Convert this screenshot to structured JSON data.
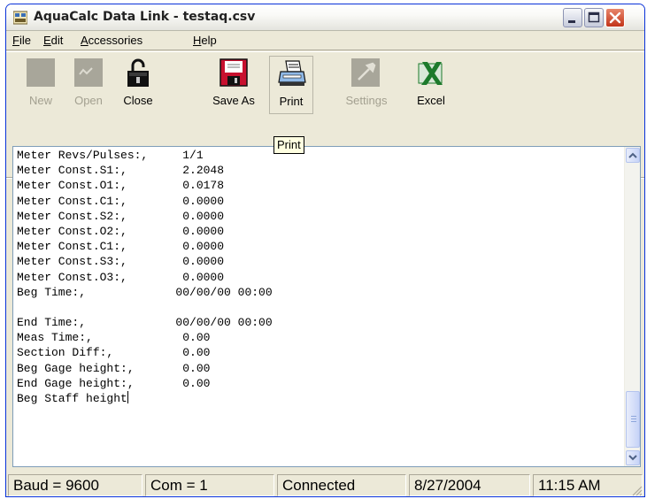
{
  "window": {
    "title": "AquaCalc Data Link - testaq.csv"
  },
  "menu": {
    "items": [
      {
        "label": "File",
        "mnemonic": "F",
        "rest": "ile"
      },
      {
        "label": "Edit",
        "mnemonic": "E",
        "rest": "dit"
      },
      {
        "label": "Accessories",
        "mnemonic": "A",
        "rest": "ccessories"
      },
      {
        "label": "Help",
        "mnemonic": "H",
        "rest": "elp"
      }
    ]
  },
  "toolbar": {
    "new_label": "New",
    "open_label": "Open",
    "close_label": "Close",
    "saveas_label": "Save As",
    "print_label": "Print",
    "settings_label": "Settings",
    "excel_label": "Excel"
  },
  "tooltip": {
    "text": "Print"
  },
  "document": {
    "lines": [
      "Meter Revs/Pulses:,     1/1",
      "Meter Const.S1:,        2.2048",
      "Meter Const.O1:,        0.0178",
      "Meter Const.C1:,        0.0000",
      "Meter Const.S2:,        0.0000",
      "Meter Const.O2:,        0.0000",
      "Meter Const.C1:,        0.0000",
      "Meter Const.S3:,        0.0000",
      "Meter Const.O3:,        0.0000",
      "Beg Time:,             00/00/00 00:00",
      "",
      "End Time:,             00/00/00 00:00",
      "Meas Time:,             0.00",
      "Section Diff:,          0.00",
      "Beg Gage height:,       0.00",
      "End Gage height:,       0.00",
      "Beg Staff height"
    ]
  },
  "statusbar": {
    "baud": "Baud = 9600",
    "com": "Com = 1",
    "connection": "Connected",
    "date": "8/27/2004",
    "time": "11:15 AM"
  },
  "colors": {
    "window_frame": "#0831d9",
    "close_button": "#c2351a",
    "excel_green": "#1d7a2c",
    "saveas_red": "#c8102e"
  }
}
